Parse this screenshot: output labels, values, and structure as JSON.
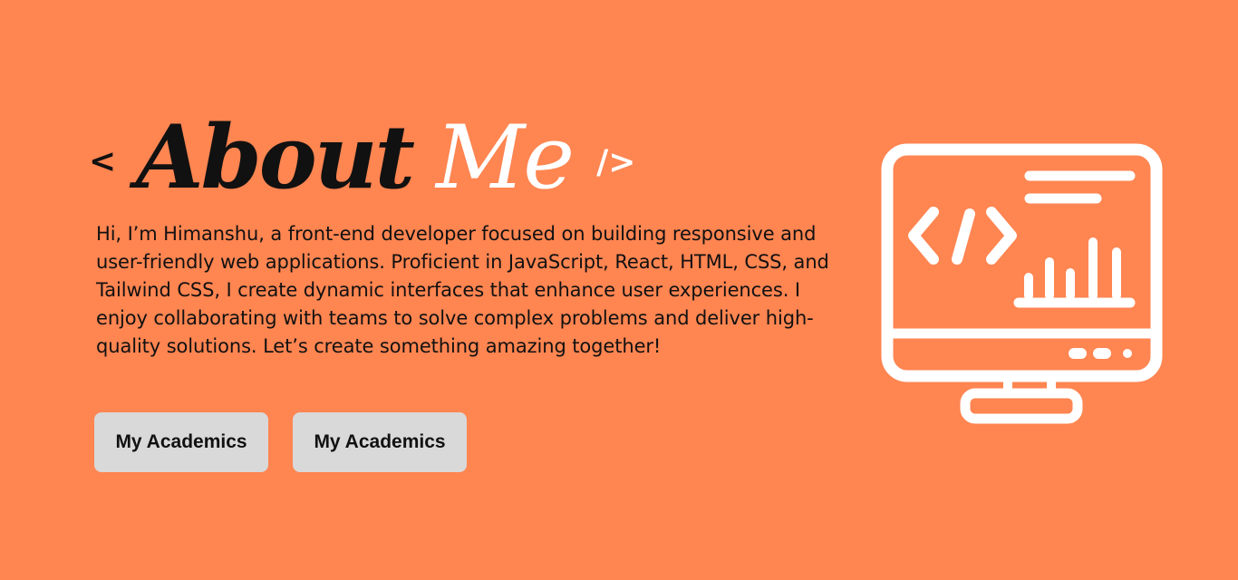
{
  "about": {
    "bracket_open": "<",
    "title_word_1": "About",
    "title_word_2": "Me",
    "bracket_close": "/>",
    "bio": "Hi, I’m Himanshu, a front-end developer focused on building responsive and user-friendly web applications. Proficient in JavaScript, React, HTML, CSS, and Tailwind CSS, I create dynamic interfaces that enhance user experiences. I enjoy collaborating with teams to solve complex problems and deliver high-quality solutions. Let’s create something amazing together!",
    "buttons": [
      {
        "label": "My Academics"
      },
      {
        "label": "My Academics"
      }
    ]
  },
  "illustration": {
    "icon": "computer-code-monitor-icon",
    "code_glyph": "</>"
  },
  "colors": {
    "background": "#FF8551",
    "button_bg": "#D9D9D9",
    "text_dark": "#111111",
    "accent_light": "#FFFFFF"
  }
}
